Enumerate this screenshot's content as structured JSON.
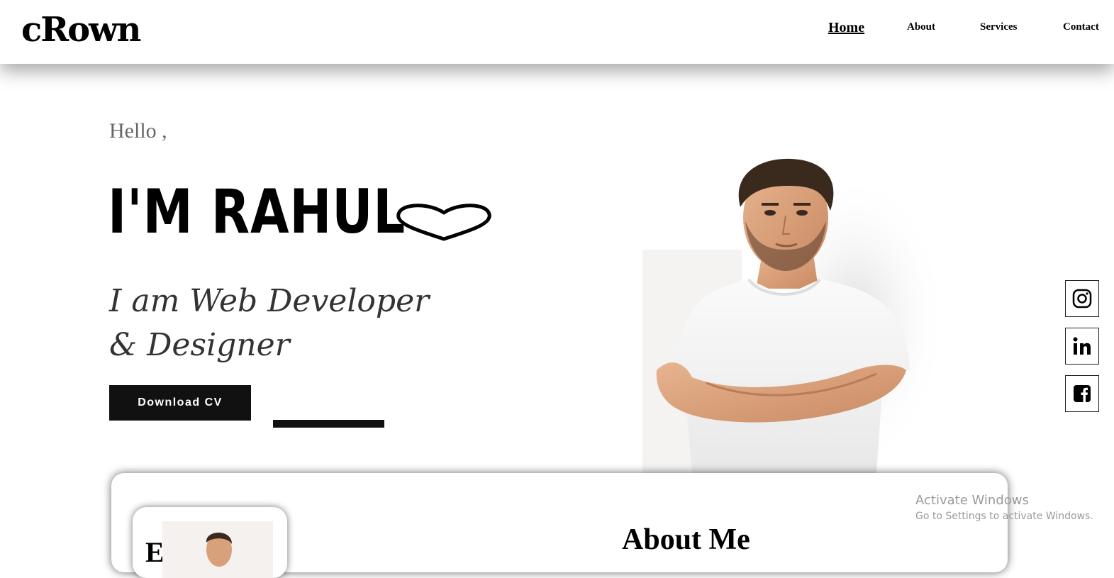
{
  "header": {
    "logo": "cRown",
    "nav": [
      {
        "label": "Home",
        "active": true
      },
      {
        "label": "About",
        "active": false
      },
      {
        "label": "Services",
        "active": false
      },
      {
        "label": "Contact",
        "active": false
      }
    ]
  },
  "hero": {
    "greeting": "Hello ,",
    "name": "I'M RAHUL",
    "decor_icon": "heart-icon",
    "tagline_line1": "I am Web Developer",
    "tagline_line2": "& Designer",
    "cv_button": "Download CV",
    "portrait_icon": "person-portrait"
  },
  "social": [
    {
      "icon": "instagram-icon"
    },
    {
      "icon": "linkedin-icon"
    },
    {
      "icon": "facebook-icon"
    }
  ],
  "about": {
    "title": "About Me",
    "thumb_letter": "E"
  },
  "watermark": {
    "title": "Activate Windows",
    "subtitle": "Go to Settings to activate Windows."
  },
  "colors": {
    "accent": "#111111",
    "background": "#ffffff",
    "muted_text": "#666666"
  }
}
